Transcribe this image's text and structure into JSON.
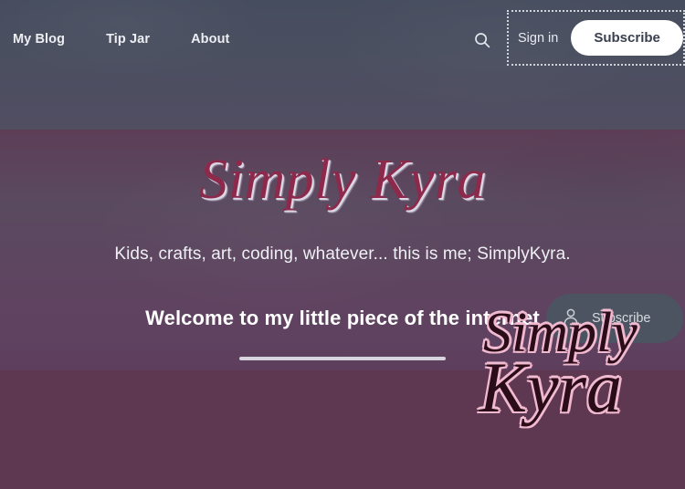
{
  "site": {
    "brand": "Simply Kyra",
    "brand_part_1": "S",
    "brand_part_1_rest": "imply ",
    "brand_part_2": "K",
    "brand_part_2_rest": "yra"
  },
  "header": {
    "nav_items": [
      {
        "label": "My Blog",
        "name": "nav-link-my-blog"
      },
      {
        "label": "Tip Jar",
        "name": "nav-link-tip-jar"
      },
      {
        "label": "About",
        "name": "nav-link-about"
      }
    ],
    "search_icon": "search-icon",
    "sign_in_label": "Sign in",
    "subscribe_label": "Subscribe",
    "focus_ring": true
  },
  "hero": {
    "logo_text": "Simply Kyra",
    "tagline": "Kids, crafts, art, coding, whatever... this is me; SimplyKyra.",
    "heading": "Welcome to my little piece of the internet",
    "divider": true
  },
  "floating_subscribe": {
    "icon": "person-icon",
    "label": "Subscribe"
  },
  "watermark": {
    "line1": "Simply",
    "line2": "Kyra"
  },
  "colors": {
    "hero_gradient_top": "#464d5e",
    "hero_gradient_bottom": "#5d3e5c",
    "bottom_band": "#5e3751",
    "logo_maroon": "#8d2a4b",
    "logo_shadow": "#e2deec",
    "subscribe_bg": "#ffffff",
    "subscribe_text": "#3a4050",
    "nav_text": "#eceef2",
    "focus_ring": "#cfd4dd",
    "divider": "#d8d4de",
    "float_pill_bg": "rgba(74,86,98,0.88)",
    "watermark_fill": "#2a0d18",
    "watermark_outline": "#f0b9cf"
  }
}
